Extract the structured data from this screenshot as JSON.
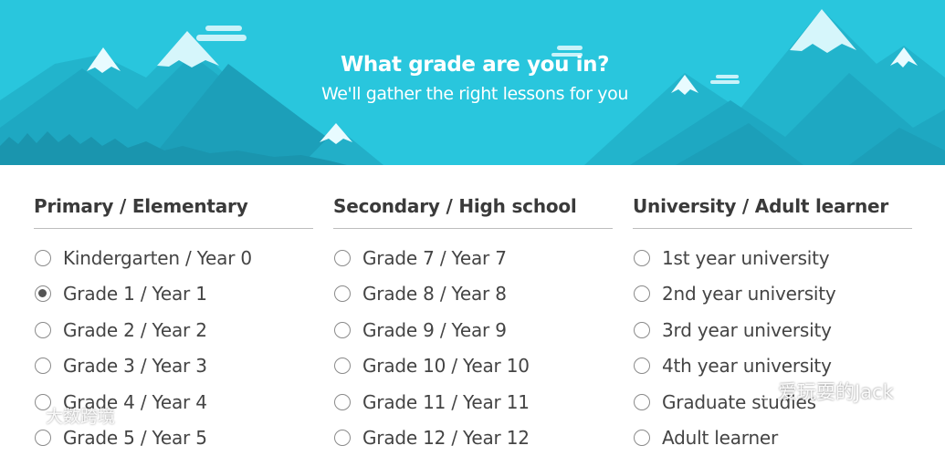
{
  "banner": {
    "title": "What grade are you in?",
    "subtitle": "We'll gather the right lessons for you",
    "bg_color": "#29c6dd"
  },
  "columns": [
    {
      "heading": "Primary / Elementary",
      "options": [
        {
          "label": "Kindergarten / Year 0",
          "selected": false
        },
        {
          "label": "Grade 1 / Year 1",
          "selected": true
        },
        {
          "label": "Grade 2 / Year 2",
          "selected": false
        },
        {
          "label": "Grade 3 / Year 3",
          "selected": false
        },
        {
          "label": "Grade 4 / Year 4",
          "selected": false
        },
        {
          "label": "Grade 5 / Year 5",
          "selected": false
        }
      ]
    },
    {
      "heading": "Secondary / High school",
      "options": [
        {
          "label": "Grade 7 / Year 7",
          "selected": false
        },
        {
          "label": "Grade 8 / Year 8",
          "selected": false
        },
        {
          "label": "Grade 9 / Year 9",
          "selected": false
        },
        {
          "label": "Grade 10 / Year 10",
          "selected": false
        },
        {
          "label": "Grade 11 / Year 11",
          "selected": false
        },
        {
          "label": "Grade 12 / Year 12",
          "selected": false
        }
      ]
    },
    {
      "heading": "University / Adult learner",
      "options": [
        {
          "label": "1st year university",
          "selected": false
        },
        {
          "label": "2nd year university",
          "selected": false
        },
        {
          "label": "3rd year university",
          "selected": false
        },
        {
          "label": "4th year university",
          "selected": false
        },
        {
          "label": "Graduate studies",
          "selected": false
        },
        {
          "label": "Adult learner",
          "selected": false
        }
      ]
    }
  ],
  "watermarks": {
    "left": "大数跨境",
    "right": "爱玩耍的Jack"
  }
}
